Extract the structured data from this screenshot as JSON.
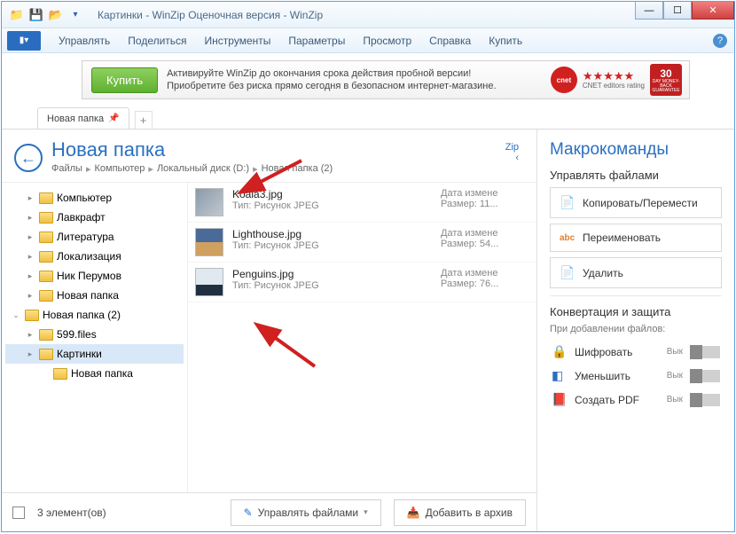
{
  "title": "Картинки - WinZip Оценочная версия - WinZip",
  "menu": [
    "Управлять",
    "Поделиться",
    "Инструменты",
    "Параметры",
    "Просмотр",
    "Справка",
    "Купить"
  ],
  "banner": {
    "buy": "Купить",
    "line1": "Активируйте WinZip до окончания срока действия пробной версии!",
    "line2": "Приобретите без риска прямо сегодня в безопасном интернет-магазине.",
    "cnet": "cnet",
    "rating": "CNET editors rating",
    "badge_num": "30",
    "badge_txt": "DAY MONEY-BACK GUARANTEE"
  },
  "tab": "Новая папка",
  "folder_title": "Новая папка",
  "breadcrumb": [
    "Файлы",
    "Компьютер",
    "Локальный диск (D:)",
    "Новая папка (2)"
  ],
  "zip": "Zip",
  "tree": [
    {
      "indent": 1,
      "chev": "▸",
      "label": "Компьютер"
    },
    {
      "indent": 1,
      "chev": "▸",
      "label": "Лавкрафт"
    },
    {
      "indent": 1,
      "chev": "▸",
      "label": "Литература"
    },
    {
      "indent": 1,
      "chev": "▸",
      "label": "Локализация"
    },
    {
      "indent": 1,
      "chev": "▸",
      "label": "Ник Перумов"
    },
    {
      "indent": 1,
      "chev": "▸",
      "label": "Новая папка"
    },
    {
      "indent": 0,
      "chev": "⌄",
      "label": "Новая папка (2)"
    },
    {
      "indent": 1,
      "chev": "▸",
      "label": "599.files"
    },
    {
      "indent": 1,
      "chev": "▸",
      "label": "Картинки",
      "sel": true
    },
    {
      "indent": 2,
      "chev": "",
      "label": "Новая папка"
    }
  ],
  "files": [
    {
      "name": "Koala3.jpg",
      "type": "Тип: Рисунок JPEG",
      "m1": "Дата измене",
      "m2": "Размер: 11...",
      "t": "t1"
    },
    {
      "name": "Lighthouse.jpg",
      "type": "Тип: Рисунок JPEG",
      "m1": "Дата измене",
      "m2": "Размер: 54...",
      "t": "t2"
    },
    {
      "name": "Penguins.jpg",
      "type": "Тип: Рисунок JPEG",
      "m1": "Дата измене",
      "m2": "Размер: 76...",
      "t": "t3"
    }
  ],
  "status": "3 элемент(ов)",
  "bottom": {
    "manage": "Управлять файлами",
    "add": "Добавить в архив"
  },
  "right": {
    "title": "Макрокоманды",
    "s1": "Управлять файлами",
    "btns": [
      {
        "ico": "📄",
        "label": "Копировать/Перемести"
      },
      {
        "ico": "abc",
        "label": "Переименовать",
        "cls": "abc"
      },
      {
        "ico": "📄",
        "label": "Удалить"
      }
    ],
    "s2": "Конвертация и защита",
    "sub": "При добавлении файлов:",
    "toggles": [
      {
        "ico": "🔒",
        "label": "Шифровать",
        "state": "Вык"
      },
      {
        "ico": "◧",
        "label": "Уменьшить",
        "state": "Вык"
      },
      {
        "ico": "📕",
        "label": "Создать PDF",
        "state": "Вык"
      }
    ]
  }
}
